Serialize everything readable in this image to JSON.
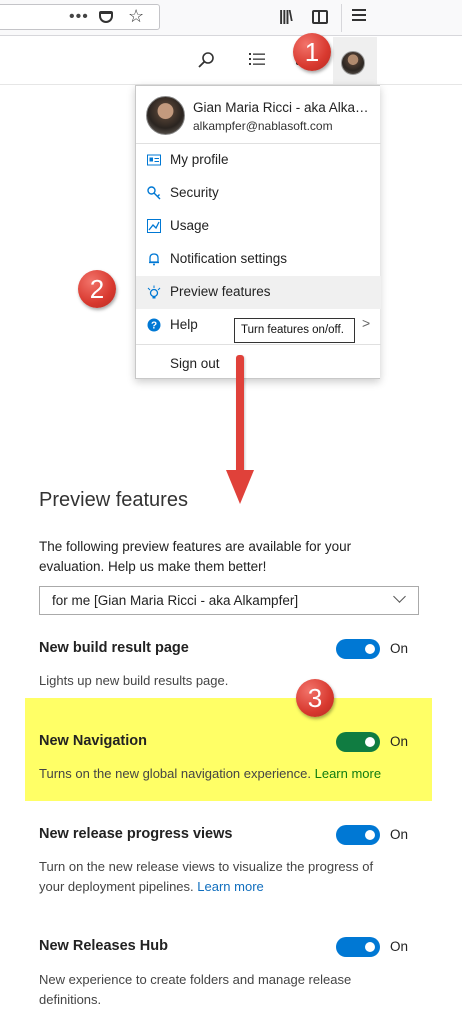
{
  "browser": {
    "url_more_icon": "more-dots-icon",
    "pocket_icon": "pocket-icon",
    "star_icon": "bookmark-star-icon",
    "library_icon": "library-icon",
    "sidebar_icon": "sidebar-icon",
    "menu_icon": "hamburger-menu-icon"
  },
  "header": {
    "search_icon": "search-icon",
    "tasks_icon": "task-list-icon",
    "marketplace_icon": "shopping-bag-icon",
    "avatar_icon": "user-avatar"
  },
  "callouts": [
    "1",
    "2",
    "3"
  ],
  "profile_menu": {
    "name": "Gian Maria Ricci - aka Alka…",
    "email": "alkampfer@nablasoft.com",
    "items": [
      {
        "label": "My profile",
        "icon": "id-card-icon"
      },
      {
        "label": "Security",
        "icon": "key-icon"
      },
      {
        "label": "Usage",
        "icon": "usage-chart-icon"
      },
      {
        "label": "Notification settings",
        "icon": "bell-icon"
      },
      {
        "label": "Preview features",
        "icon": "preview-sparkle-icon"
      },
      {
        "label": "Help",
        "icon": "help-circle-icon"
      }
    ],
    "sign_out": "Sign out",
    "tooltip": "Turn features on/off."
  },
  "preview": {
    "title": "Preview features",
    "description": "The following preview features are available for your evaluation. Help us make them better!",
    "scope_select": "for me [Gian Maria Ricci - aka Alkampfer]",
    "features": [
      {
        "name": "New build result page",
        "desc": "Lights up new build results page.",
        "link": "",
        "state": "On",
        "enabled": true
      },
      {
        "name": "New Navigation",
        "desc": "Turns on the new global navigation experience.",
        "link": "Learn more",
        "state": "On",
        "enabled": true
      },
      {
        "name": "New release progress views",
        "desc": "Turn on the new release views to visualize the progress of your deployment pipelines.",
        "link": "Learn more",
        "state": "On",
        "enabled": true
      },
      {
        "name": "New Releases Hub",
        "desc": "New experience to create folders and manage release definitions.",
        "link": "",
        "state": "On",
        "enabled": true
      }
    ]
  },
  "colors": {
    "accent": "#0078d4",
    "toggle_green": "#107c41",
    "highlight": "#ffff66",
    "callout_red": "#d8392f"
  }
}
